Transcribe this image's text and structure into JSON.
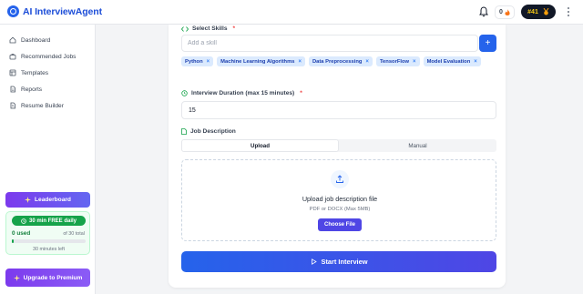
{
  "header": {
    "brand": "AI InterviewAgent",
    "streak_count": "0",
    "rank": "#41"
  },
  "sidebar": {
    "items": [
      {
        "label": "Dashboard",
        "icon": "home-icon"
      },
      {
        "label": "Recommended Jobs",
        "icon": "briefcase-icon"
      },
      {
        "label": "Templates",
        "icon": "template-icon"
      },
      {
        "label": "Reports",
        "icon": "report-icon"
      },
      {
        "label": "Resume Builder",
        "icon": "resume-icon"
      }
    ],
    "leaderboard_label": "Leaderboard",
    "free_label": "30 min FREE daily",
    "used_label": "0 used",
    "total_label": "of 30 total",
    "usage_fraction": 0.03,
    "minutes_left": "30 minutes left",
    "upgrade_label": "Upgrade to Premium"
  },
  "form": {
    "skills_label": "Select Skills",
    "required_mark": "*",
    "skill_placeholder": "Add a skill",
    "add_label": "+",
    "skills": [
      "Python",
      "Machine Learning Algorithms",
      "Data Preprocessing",
      "TensorFlow",
      "Model Evaluation"
    ],
    "remove_glyph": "×",
    "duration_label": "Interview Duration (max 15 minutes)",
    "duration_value": "15",
    "jd_label": "Job Description",
    "tabs": [
      "Upload",
      "Manual"
    ],
    "upload_title": "Upload job description file",
    "upload_sub": "PDF or DOCX (Max 5MB)",
    "choose_file": "Choose File",
    "start_label": "Start Interview"
  },
  "colors": {
    "primary": "#2563eb",
    "accent": "#7c3aed",
    "success": "#16a34a"
  }
}
